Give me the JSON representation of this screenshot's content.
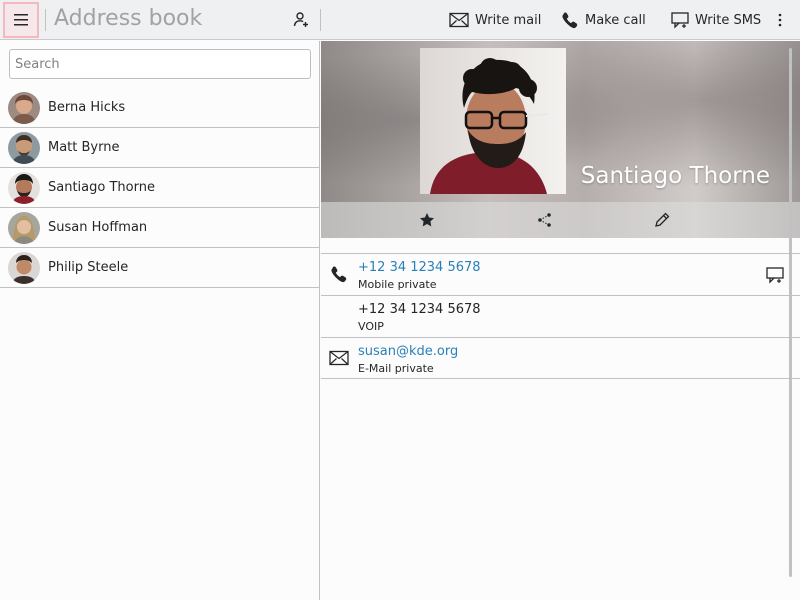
{
  "toolbar": {
    "app_title": "Address book",
    "actions": [
      {
        "label": "Write mail",
        "icon": "mail-icon"
      },
      {
        "label": "Make call",
        "icon": "phone-icon"
      },
      {
        "label": "Write SMS",
        "icon": "sms-icon"
      }
    ]
  },
  "search": {
    "placeholder": "Search"
  },
  "contacts": [
    {
      "name": "Berna Hicks"
    },
    {
      "name": "Matt Byrne"
    },
    {
      "name": "Santiago Thorne"
    },
    {
      "name": "Susan Hoffman"
    },
    {
      "name": "Philip Steele"
    }
  ],
  "selected_contact": {
    "name": "Santiago Thorne",
    "details": [
      {
        "value": "+12 34 1234 5678",
        "label": "Mobile private",
        "icon": "phone-icon",
        "is_link": true,
        "action_icon": "sms-icon"
      },
      {
        "value": "+12 34 1234 5678",
        "label": "VOIP",
        "icon": "",
        "is_link": false
      },
      {
        "value": "susan@kde.org",
        "label": "E-Mail private",
        "icon": "mail-icon",
        "is_link": true
      }
    ]
  },
  "colors": {
    "accent": "#2980b9",
    "toolbar_bg": "#eff0f1",
    "highlight": "#f4b8c0"
  }
}
